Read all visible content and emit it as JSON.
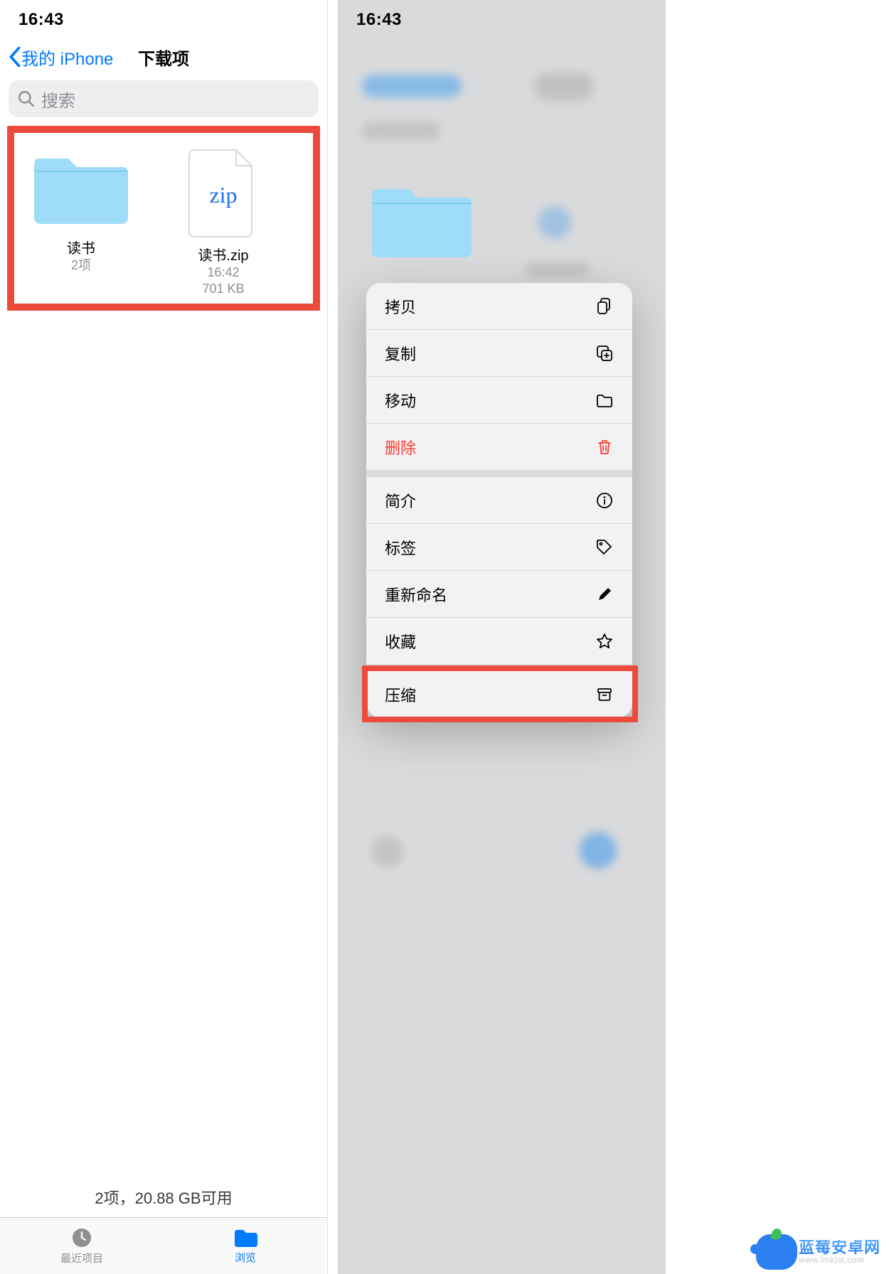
{
  "left": {
    "status_time": "16:43",
    "back_label": "我的 iPhone",
    "title": "下载项",
    "search_placeholder": "搜索",
    "items": [
      {
        "name": "读书",
        "sub": "2项",
        "kind": "folder"
      },
      {
        "name": "读书.zip",
        "time": "16:42",
        "size": "701 KB",
        "kind": "zip"
      }
    ],
    "footer": "2项，20.88 GB可用",
    "tabs": {
      "recent": "最近项目",
      "browse": "浏览"
    }
  },
  "right": {
    "status_time": "16:43",
    "menu": [
      {
        "label": "拷贝",
        "icon": "copy-docs"
      },
      {
        "label": "复制",
        "icon": "duplicate"
      },
      {
        "label": "移动",
        "icon": "folder"
      },
      {
        "label": "删除",
        "icon": "trash",
        "danger": true,
        "gap_after": true
      },
      {
        "label": "简介",
        "icon": "info"
      },
      {
        "label": "标签",
        "icon": "tag"
      },
      {
        "label": "重新命名",
        "icon": "pencil"
      },
      {
        "label": "收藏",
        "icon": "star",
        "gap_after": true
      },
      {
        "label": "压缩",
        "icon": "archive"
      }
    ]
  },
  "watermark": {
    "title": "蓝莓安卓网",
    "sub": "www.lmkjst.com"
  }
}
